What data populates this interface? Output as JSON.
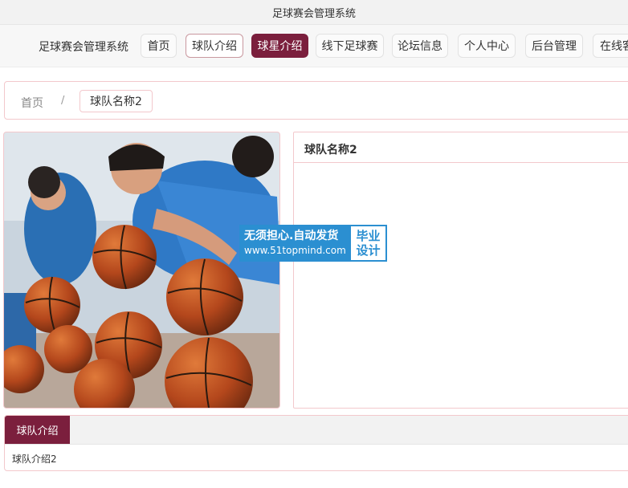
{
  "window": {
    "title": "足球赛会管理系统"
  },
  "nav": {
    "brand": "足球赛会管理系统",
    "items": [
      {
        "label": "首页"
      },
      {
        "label": "球队介绍"
      },
      {
        "label": "球星介绍"
      },
      {
        "label": "线下足球赛"
      },
      {
        "label": "论坛信息"
      },
      {
        "label": "个人中心"
      },
      {
        "label": "后台管理"
      },
      {
        "label": "在线客"
      }
    ]
  },
  "breadcrumb": {
    "home": "首页",
    "separator": "/",
    "current": "球队名称2"
  },
  "team": {
    "name": "球队名称2",
    "photo_icon": "basketball-training-photo"
  },
  "watermark": {
    "line1": "无须担心.自动发货",
    "line2": "www.51topmind.com",
    "badge_line1": "毕业",
    "badge_line2": "设计"
  },
  "intro": {
    "tab_label": "球队介绍",
    "content": "球队介绍2"
  },
  "colors": {
    "accent": "#7b1f3d",
    "border_pink": "#f3c8cc",
    "watermark_blue": "#2b8fd1"
  }
}
